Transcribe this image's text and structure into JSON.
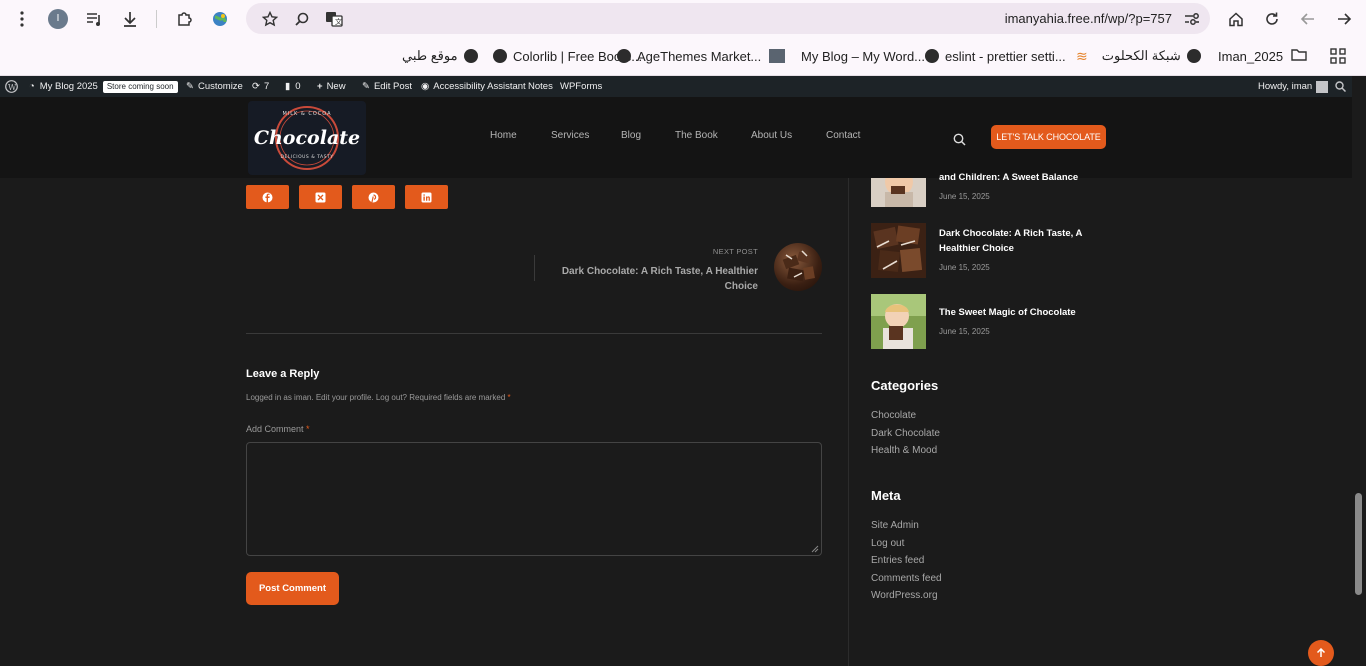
{
  "browser": {
    "url": "imanyahia.free.nf/wp/?p=757",
    "profile_initial": "I"
  },
  "bookmarks": [
    {
      "label": "موقع طبي"
    },
    {
      "label": "Colorlib | Free Boots..."
    },
    {
      "label": "AgeThemes Market..."
    },
    {
      "label": "My Blog – My Word..."
    },
    {
      "label": "eslint - prettier setti..."
    },
    {
      "label": "شبكة الكحلوت"
    },
    {
      "label": "Iman_2025"
    }
  ],
  "admin_bar": {
    "site_name": "My Blog 2025",
    "badge": "Store coming soon",
    "customize": "Customize",
    "updates": "7",
    "comments": "0",
    "new": "New",
    "edit_post": "Edit Post",
    "accessibility": "Accessibility Assistant",
    "notes": "Notes",
    "wpforms": "WPForms",
    "howdy": "Howdy, iman"
  },
  "header": {
    "logo_text": "Chocolate",
    "logo_top_text": "MILK & COCOA",
    "logo_bottom_text": "DELICIOUS & TASTY",
    "nav": [
      "Home",
      "Services",
      "Blog",
      "The Book",
      "About Us",
      "Contact"
    ],
    "cta": "LET'S TALK CHOCOLATE"
  },
  "share_icons": [
    "facebook-icon",
    "x-icon",
    "pinterest-icon",
    "linkedin-icon"
  ],
  "next_post": {
    "label": "NEXT POST",
    "title": "Dark Chocolate: A Rich Taste, A Healthier Choice"
  },
  "comments": {
    "title": "Leave a Reply",
    "logged_in": "Logged in as iman. Edit your profile. Log out? Required fields are marked",
    "required_mark": "*",
    "label": "Add Comment",
    "submit": "Post Comment"
  },
  "sidebar": {
    "recent_posts": [
      {
        "title": "and Children: A Sweet Balance",
        "date": "June 15, 2025"
      },
      {
        "title": "Dark Chocolate: A Rich Taste, A Healthier Choice",
        "date": "June 15, 2025"
      },
      {
        "title": "The Sweet Magic of Chocolate",
        "date": "June 15, 2025"
      }
    ],
    "categories_title": "Categories",
    "categories": [
      "Chocolate",
      "Dark Chocolate",
      "Health & Mood"
    ],
    "meta_title": "Meta",
    "meta_links": [
      "Site Admin",
      "Log out",
      "Entries feed",
      "Comments feed",
      "WordPress.org"
    ]
  },
  "colors": {
    "accent": "#e35a1c",
    "page_bg": "#1b1b1b",
    "header_bg": "#141414",
    "admin_bar_bg": "#1d2327"
  }
}
